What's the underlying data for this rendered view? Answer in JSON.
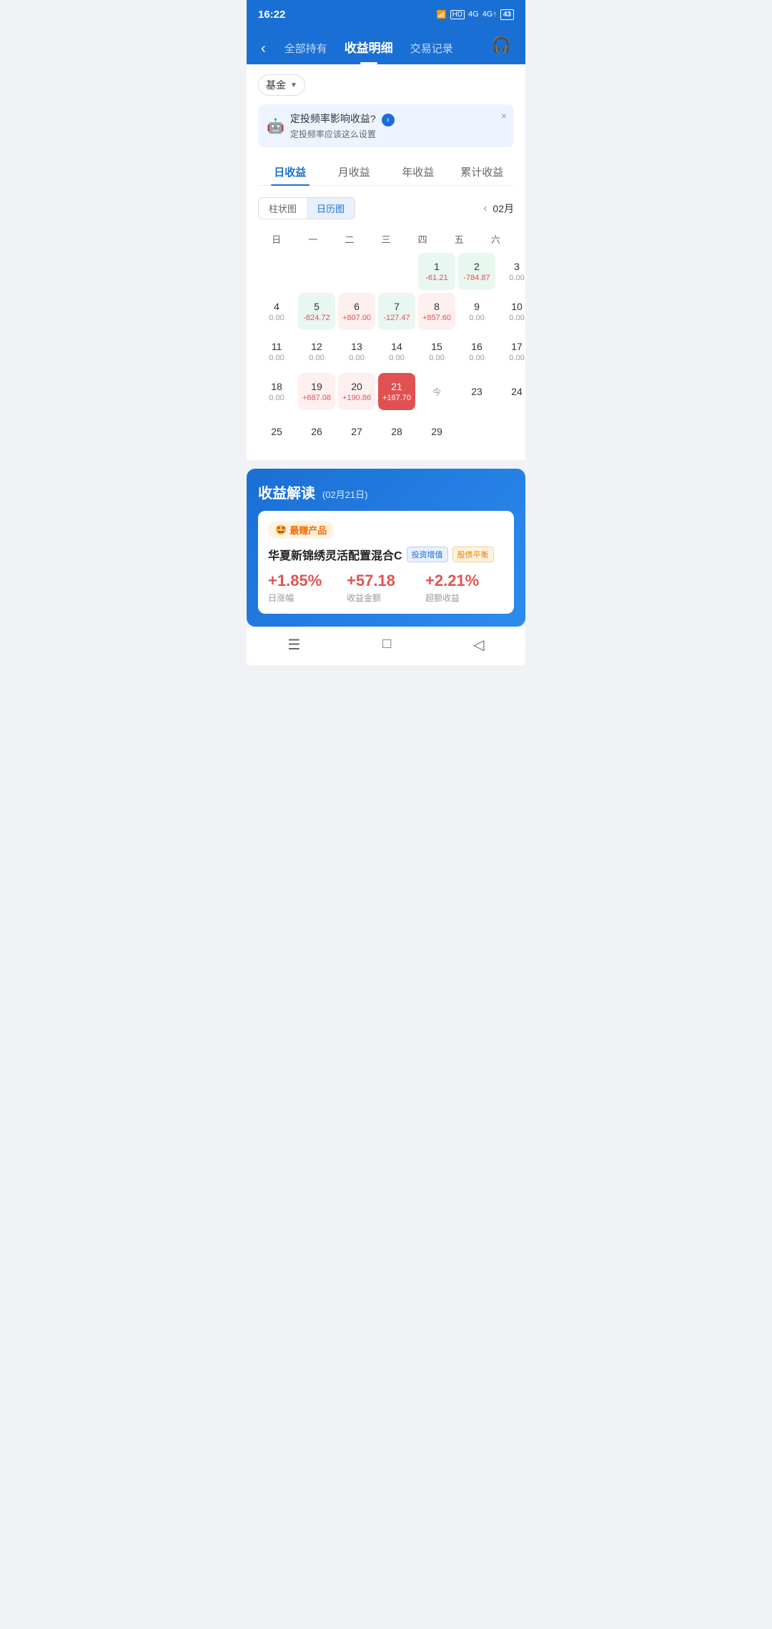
{
  "statusBar": {
    "time": "16:22",
    "battery": "43"
  },
  "header": {
    "backLabel": "‹",
    "tabs": [
      {
        "id": "all",
        "label": "全部持有",
        "active": false
      },
      {
        "id": "income",
        "label": "收益明细",
        "active": true
      },
      {
        "id": "trade",
        "label": "交易记录",
        "active": false
      }
    ],
    "serviceIcon": "🎧"
  },
  "fundSelector": {
    "label": "基金",
    "arrow": "▼"
  },
  "banner": {
    "icon": "🤖",
    "title": "定投频率影响收益?",
    "arrowLabel": "›",
    "subtitle": "定投频率应该这么设置",
    "closeLabel": "×"
  },
  "periodTabs": [
    {
      "id": "daily",
      "label": "日收益",
      "active": true
    },
    {
      "id": "monthly",
      "label": "月收益",
      "active": false
    },
    {
      "id": "yearly",
      "label": "年收益",
      "active": false
    },
    {
      "id": "total",
      "label": "累计收益",
      "active": false
    }
  ],
  "chartTypeTabs": [
    {
      "id": "bar",
      "label": "柱状图",
      "active": false
    },
    {
      "id": "calendar",
      "label": "日历图",
      "active": true
    }
  ],
  "monthNav": {
    "arrow": "‹",
    "month": "02月"
  },
  "calendar": {
    "daysOfWeek": [
      "日",
      "一",
      "二",
      "三",
      "四",
      "五",
      "六"
    ],
    "weeks": [
      [
        {
          "day": "",
          "val": "",
          "type": "empty"
        },
        {
          "day": "",
          "val": "",
          "type": "empty"
        },
        {
          "day": "",
          "val": "",
          "type": "empty"
        },
        {
          "day": "",
          "val": "",
          "type": "empty"
        },
        {
          "day": "1",
          "val": "-61.21",
          "type": "green",
          "valClass": "gain-red"
        },
        {
          "day": "2",
          "val": "-784.87",
          "type": "green",
          "valClass": "gain-red"
        },
        {
          "day": "3",
          "val": "0.00",
          "type": "normal"
        }
      ],
      [
        {
          "day": "4",
          "val": "0.00",
          "type": "normal"
        },
        {
          "day": "5",
          "val": "-824.72",
          "type": "green",
          "valClass": "gain-red"
        },
        {
          "day": "6",
          "val": "+807.00",
          "type": "red-light",
          "valClass": "gain-red"
        },
        {
          "day": "7",
          "val": "-127.47",
          "type": "green",
          "valClass": "gain-red"
        },
        {
          "day": "8",
          "val": "+857.60",
          "type": "red-light",
          "valClass": "gain-red"
        },
        {
          "day": "9",
          "val": "0.00",
          "type": "normal"
        },
        {
          "day": "10",
          "val": "0.00",
          "type": "normal"
        }
      ],
      [
        {
          "day": "11",
          "val": "0.00",
          "type": "normal"
        },
        {
          "day": "12",
          "val": "0.00",
          "type": "normal"
        },
        {
          "day": "13",
          "val": "0.00",
          "type": "normal"
        },
        {
          "day": "14",
          "val": "0.00",
          "type": "normal"
        },
        {
          "day": "15",
          "val": "0.00",
          "type": "normal"
        },
        {
          "day": "16",
          "val": "0.00",
          "type": "normal"
        },
        {
          "day": "17",
          "val": "0.00",
          "type": "normal"
        }
      ],
      [
        {
          "day": "18",
          "val": "0.00",
          "type": "normal"
        },
        {
          "day": "19",
          "val": "+687.08",
          "type": "red-light",
          "valClass": "gain-red"
        },
        {
          "day": "20",
          "val": "+190.86",
          "type": "red-light",
          "valClass": "gain-red"
        },
        {
          "day": "21",
          "val": "+167.70",
          "type": "red-selected",
          "valClass": "gain-white"
        },
        {
          "day": "今",
          "val": "",
          "type": "today-label"
        },
        {
          "day": "23",
          "val": "",
          "type": "normal"
        },
        {
          "day": "24",
          "val": "",
          "type": "normal"
        }
      ],
      [
        {
          "day": "25",
          "val": "",
          "type": "normal"
        },
        {
          "day": "26",
          "val": "",
          "type": "normal"
        },
        {
          "day": "27",
          "val": "",
          "type": "normal"
        },
        {
          "day": "28",
          "val": "",
          "type": "normal"
        },
        {
          "day": "29",
          "val": "",
          "type": "normal"
        },
        {
          "day": "",
          "val": "",
          "type": "empty"
        },
        {
          "day": "",
          "val": "",
          "type": "empty"
        }
      ]
    ]
  },
  "earningsSection": {
    "title": "收益解读",
    "date": "(02月21日)",
    "badge": {
      "emoji": "🤩",
      "label": "最赚产品"
    },
    "productName": "华夏新锦绣灵活配置混合C",
    "tags": [
      {
        "label": "投资增值",
        "type": "blue"
      },
      {
        "label": "股债平衡",
        "type": "orange"
      }
    ],
    "metrics": [
      {
        "value": "+1.85%",
        "label": "日涨幅"
      },
      {
        "value": "+57.18",
        "label": "收益金额"
      },
      {
        "value": "+2.21%",
        "label": "超额收益"
      }
    ]
  },
  "bottomNav": [
    {
      "id": "menu",
      "icon": "☰",
      "label": "menu-icon"
    },
    {
      "id": "home",
      "icon": "□",
      "label": "home-icon"
    },
    {
      "id": "back",
      "icon": "◁",
      "label": "back-icon"
    }
  ]
}
